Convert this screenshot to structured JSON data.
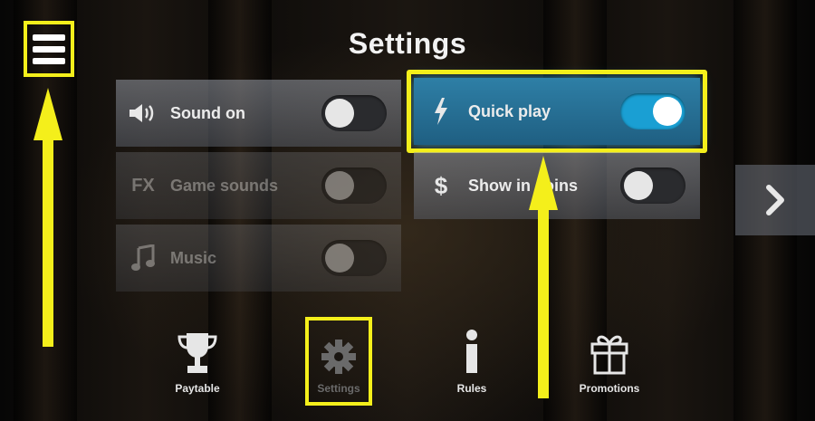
{
  "title": "Settings",
  "settings_left": [
    {
      "label": "Sound on",
      "icon": "speaker-icon",
      "state": "off",
      "enabled": true
    },
    {
      "label": "Game sounds",
      "icon": "fx-icon",
      "icon_text": "FX",
      "state": "off",
      "enabled": false
    },
    {
      "label": "Music",
      "icon": "music-note-icon",
      "state": "off",
      "enabled": false
    }
  ],
  "settings_right": [
    {
      "label": "Quick play",
      "icon": "lightning-icon",
      "state": "on",
      "highlighted": true
    },
    {
      "label": "Show in coins",
      "icon": "dollar-icon",
      "icon_text": "$",
      "state": "off"
    }
  ],
  "bottom_nav": [
    {
      "label": "Paytable",
      "icon": "trophy-icon"
    },
    {
      "label": "Settings",
      "icon": "gear-icon",
      "active": true
    },
    {
      "label": "Rules",
      "icon": "info-icon"
    },
    {
      "label": "Promotions",
      "icon": "gift-icon"
    }
  ],
  "colors": {
    "annotation": "#f4ef1b",
    "toggle_on": "#1a9fd3",
    "highlight_row": "#2e7fa6"
  }
}
